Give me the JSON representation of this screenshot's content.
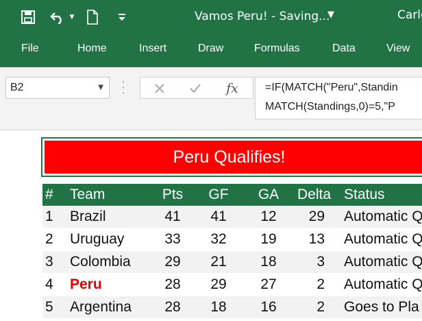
{
  "title_bar": {
    "document_title": "Vamos Peru!  -  Saving...",
    "user_name": "Carlo",
    "icons": [
      "save-icon",
      "undo-icon",
      "chevron-down-icon",
      "new-document-icon",
      "customize-qat-icon"
    ]
  },
  "ribbon": {
    "tabs": [
      "File",
      "Home",
      "Insert",
      "Draw",
      "Formulas",
      "Data",
      "View"
    ]
  },
  "formula_bar": {
    "name_box": "B2",
    "insert_function_label": "fx",
    "formula_line1": "=IF(MATCH(\"Peru\",Standin",
    "formula_line2": "MATCH(Standings,0)=5,\"P"
  },
  "sheet": {
    "banner": "Peru Qualifies!",
    "headers": [
      "#",
      "Team",
      "Pts",
      "GF",
      "GA",
      "Delta",
      "Status"
    ],
    "rows": [
      {
        "num": "1",
        "team": "Brazil",
        "pts": "41",
        "gf": "41",
        "ga": "12",
        "delta": "29",
        "status": "Automatic Q"
      },
      {
        "num": "2",
        "team": "Uruguay",
        "pts": "33",
        "gf": "32",
        "ga": "19",
        "delta": "13",
        "status": "Automatic Q"
      },
      {
        "num": "3",
        "team": "Colombia",
        "pts": "29",
        "gf": "21",
        "ga": "18",
        "delta": "3",
        "status": "Automatic Q"
      },
      {
        "num": "4",
        "team": "Peru",
        "pts": "28",
        "gf": "29",
        "ga": "27",
        "delta": "2",
        "status": "Automatic Q"
      },
      {
        "num": "5",
        "team": "Argentina",
        "pts": "28",
        "gf": "18",
        "ga": "16",
        "delta": "2",
        "status": "Goes to Pla"
      }
    ],
    "colors": {
      "excel_green": "#217346",
      "banner_red": "#ff0000",
      "highlight_team": "#e00000"
    }
  }
}
